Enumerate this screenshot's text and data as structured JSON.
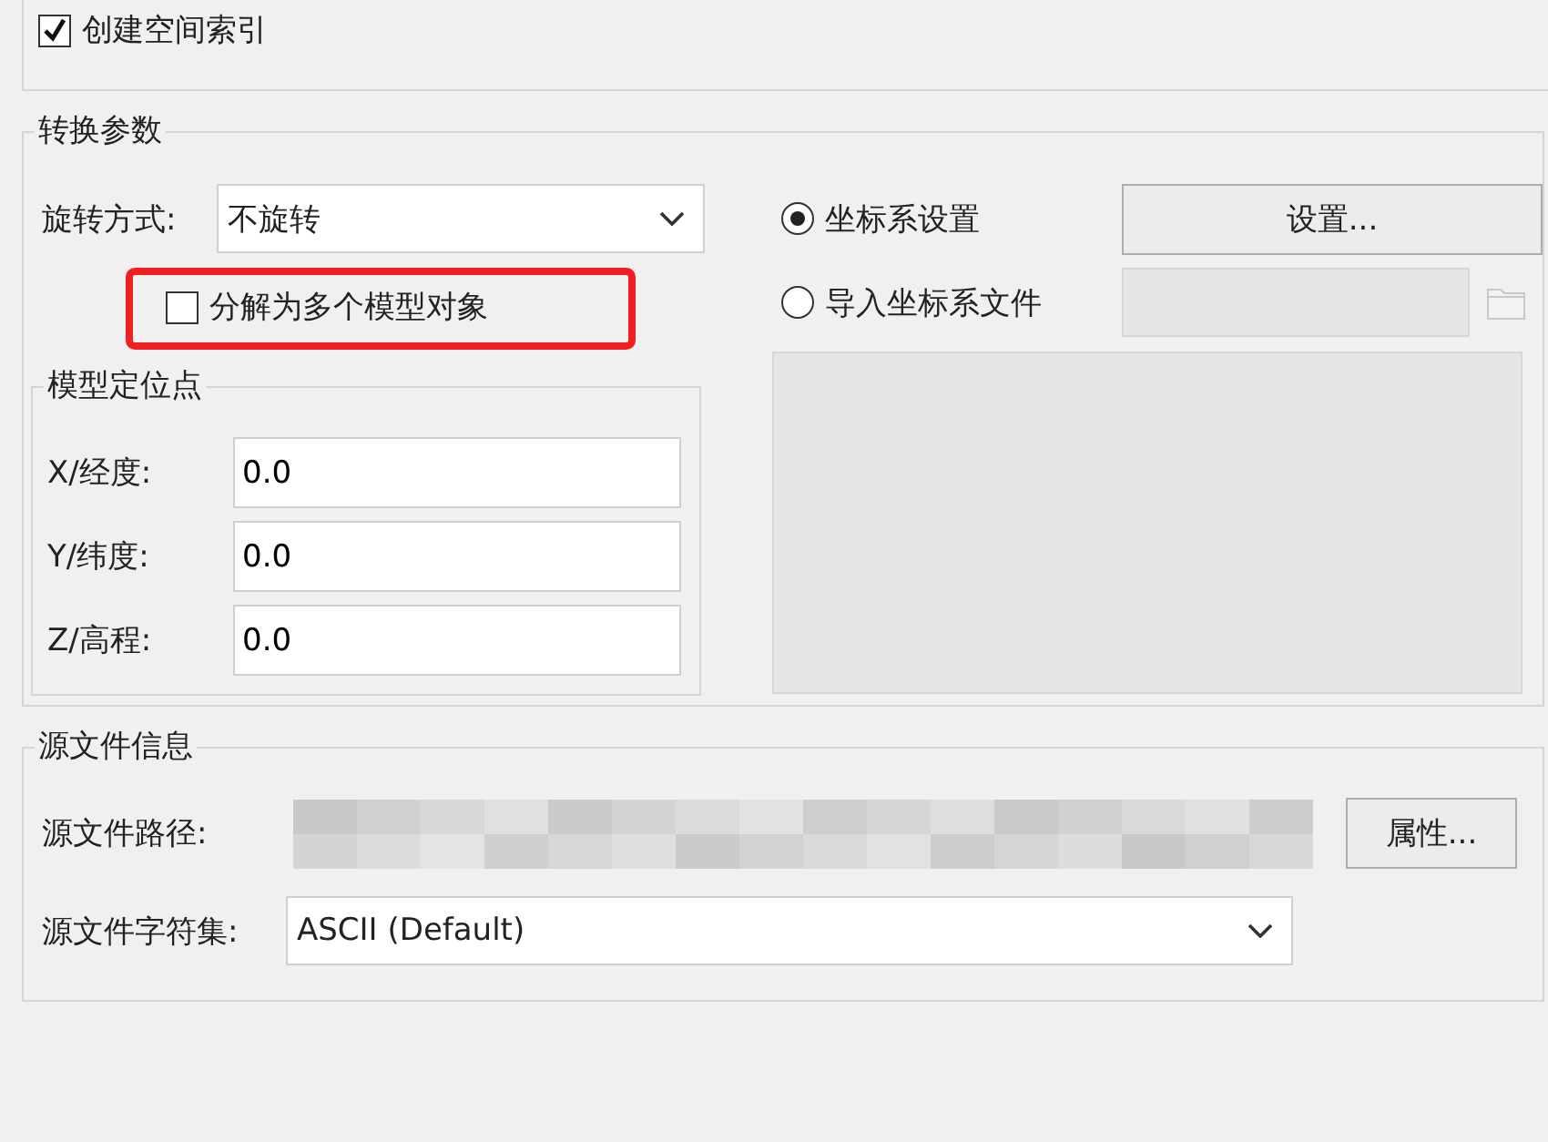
{
  "spatial_index": {
    "label": "创建空间索引",
    "checked": true
  },
  "conversion": {
    "title": "转换参数",
    "rotation": {
      "label": "旋转方式:",
      "value": "不旋转"
    },
    "decompose": {
      "label": "分解为多个模型对象",
      "checked": false,
      "highlighted": true
    },
    "anchor": {
      "title": "模型定位点",
      "fields": [
        {
          "label": "X/经度:",
          "value": "0.0"
        },
        {
          "label": "Y/纬度:",
          "value": "0.0"
        },
        {
          "label": "Z/高程:",
          "value": "0.0"
        }
      ]
    },
    "coord_options": [
      {
        "label": "坐标系设置",
        "selected": true,
        "kind": "button",
        "button": "设置..."
      },
      {
        "label": "导入坐标系文件",
        "selected": false,
        "kind": "file"
      }
    ]
  },
  "source": {
    "title": "源文件信息",
    "path_label": "源文件路径:",
    "properties_button": "属性...",
    "charset_label": "源文件字符集:",
    "charset": "ASCII (Default)"
  }
}
